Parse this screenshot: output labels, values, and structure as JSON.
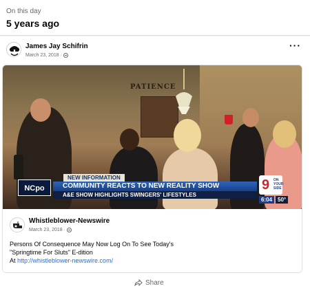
{
  "memory": {
    "subtitle": "On this day",
    "title": "5 years ago"
  },
  "post": {
    "author": "James Jay Schifrin",
    "date": "March 23, 2018 ·"
  },
  "video": {
    "wall_sign": "PATIENCE",
    "tag": "NEW INFORMATION",
    "headline": "COMMUNITY REACTS TO NEW REALITY SHOW",
    "subheadline": "A&E SHOW HIGHLIGHTS SWINGERS' LIFESTYLES",
    "station_logo": "NCpo",
    "channel_number": "9",
    "channel_sub": "ON YOUR SIDE",
    "time": "6:04",
    "temperature": "50°"
  },
  "shared": {
    "page_name": "Whistleblower-Newswire",
    "date": "March 23, 2018 ·",
    "line1": "Persons Of Consequence May Now Log On To See Today's",
    "line2": "\"Springtime For Sluts\" E-dition",
    "line3_prefix": "At ",
    "link": "http://whistleblower-newswire.com/"
  },
  "actions": {
    "share_label": "Share"
  },
  "colors": {
    "link": "#216fdb",
    "muted": "#65676b",
    "chyron_blue": "#2f63b8",
    "channel_red": "#d3232a"
  }
}
